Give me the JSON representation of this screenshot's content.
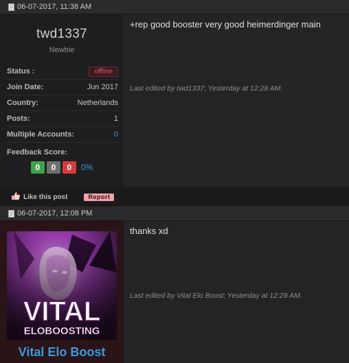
{
  "posts": [
    {
      "date": "06-07-2017, 11:38 AM",
      "username": "twd1337",
      "user_title": "Newbie",
      "status_label": "Status :",
      "status_value": "offline",
      "fields": [
        {
          "label": "Join Date:",
          "value": "Jun 2017"
        },
        {
          "label": "Country:",
          "value": "Netherlands"
        },
        {
          "label": "Posts:",
          "value": "1"
        },
        {
          "label": "Multiple Accounts:",
          "value": "0"
        }
      ],
      "feedback_label": "Feedback Score:",
      "feedback": {
        "positive": "0",
        "neutral": "0",
        "negative": "0",
        "percent": "0%"
      },
      "message": "+rep good booster very good heimerdinger main",
      "edited": "Last edited by twd1337; Yesterday at 12:28 AM.",
      "like_label": "Like this post",
      "report_label": "Report"
    },
    {
      "date": "06-07-2017, 12:08 PM",
      "banner_line1": "VITAL",
      "banner_line2": "ELOBOOSTING",
      "username": "Vital Elo Boost",
      "message": "thanks xd",
      "edited": "Last edited by Vital Elo Boost; Yesterday at 12:29 AM."
    }
  ],
  "colors": {
    "accent_blue": "#3a9ad9",
    "positive": "#3fa34d",
    "negative": "#d23c3c",
    "offline": "#e05a6a"
  },
  "icons": [
    "document-icon",
    "thumbs-up-icon"
  ]
}
